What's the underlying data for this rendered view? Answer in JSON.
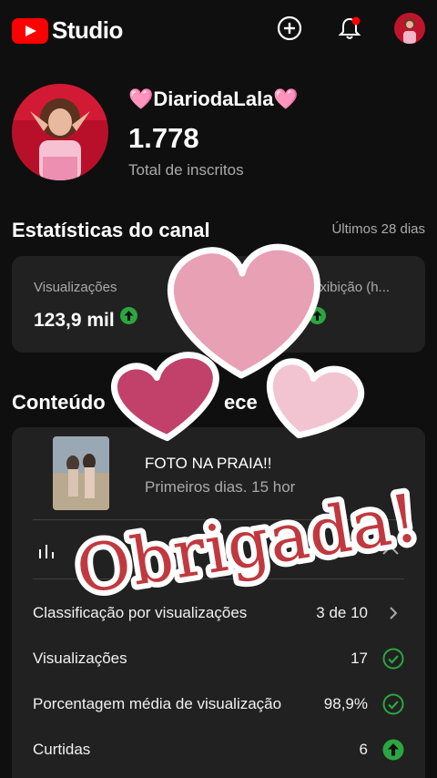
{
  "header": {
    "app_name": "Studio",
    "icons": [
      "youtube-logo-icon",
      "create-plus-icon",
      "notification-bell-icon",
      "account-avatar"
    ],
    "notification_dot_color": "#ff0000"
  },
  "channel": {
    "name": "🩷DiariodaLala🩷",
    "subscriber_count": "1.778",
    "subscriber_label": "Total de inscritos"
  },
  "stats": {
    "title": "Estatísticas do canal",
    "period": "Últimos 28 dias",
    "items": [
      {
        "label": "Visualizações",
        "value": "123,9 mil",
        "trend": "up"
      },
      {
        "label": "exibição (h...",
        "value": "",
        "trend": "up"
      }
    ]
  },
  "content": {
    "title_visible": "Conteúdo",
    "title_tail_visible": "ece",
    "video_title": "FOTO NA PRAIA!!",
    "video_subtitle": "Primeiros dias. 15 hor",
    "rows": [
      {
        "label": "Classificação por visualizações",
        "value": "3 de 10",
        "icon": "chevron-right-icon"
      },
      {
        "label": "Visualizações",
        "value": "17",
        "icon": "check-circle-icon"
      },
      {
        "label": "Porcentagem média de visualização",
        "value": "98,9%",
        "icon": "check-circle-icon"
      },
      {
        "label": "Curtidas",
        "value": "6",
        "icon": "arrow-up-circle-icon"
      }
    ]
  },
  "sticker": {
    "text": "Obrigada!",
    "colors": {
      "heart_large": "#e8a0b4",
      "heart_left": "#c1416b",
      "heart_right": "#f2c4d2",
      "text": "#c0393f"
    }
  },
  "colors": {
    "background": "#0f0f0f",
    "card": "#212121",
    "accent_green": "#2ba640",
    "check_green": "#2ba640",
    "muted_text": "#aaaaaa"
  }
}
